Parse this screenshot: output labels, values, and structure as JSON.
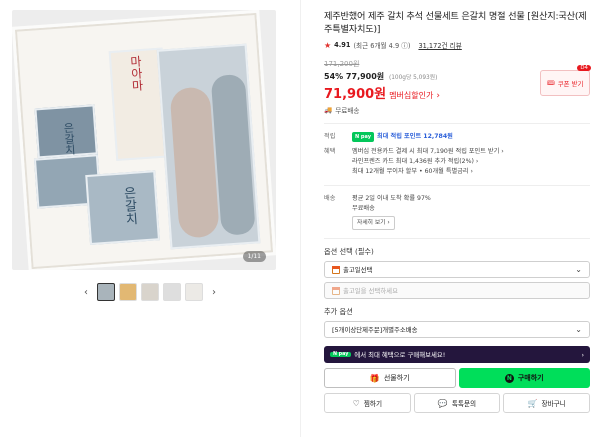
{
  "gallery": {
    "counter": "1/11",
    "pack_labels": [
      "은갈치",
      "은갈치",
      "마아마"
    ],
    "prev_arrow": "‹",
    "next_arrow": "›"
  },
  "product": {
    "title": "제주반했어 제주 갈치 추석 선물세트 은갈치 명절 선물 [원산지:국산(제주특별자치도)]",
    "rating_score": "4.91",
    "rating_note": "(최근 6개월 4.9 ⓘ)",
    "review_count": "31,172건 리뷰",
    "original_price": "171,200원",
    "sale_line": "54% 77,900원",
    "unit_price": "(100g당 5,093원)",
    "member_price": "71,900원",
    "member_label": "멤버십할인가",
    "coupon_label": "쿠폰 받기",
    "coupon_badge": "D4",
    "shipping": "무료배송"
  },
  "benefits": {
    "point_key": "적립",
    "point_badge": "N pay",
    "point_text": "최대 적립 포인트 12,784원",
    "benefit_key": "혜택",
    "benefit_lines": [
      "멤버십 전용카드 결제 시 최대 7,190원 적립 포인트 받기 ›",
      "라인프렌즈 카드 최대 1,436원 추가 적립(2%) ›",
      "최대 12개월 무이자 할부 • 60개월 특별금리 ›"
    ],
    "delivery_key": "배송",
    "delivery_lines": [
      "평균 2일 이내 도착 확률 97%",
      "무료배송"
    ],
    "more_label": "자세히 보기 ›"
  },
  "options": {
    "label": "옵션 선택 (필수)",
    "select1": "출고일선택",
    "select2": "출고일을 선택하세요",
    "add_label": "추가 옵션",
    "select3": "[5개이상단제주문]개별주소배송"
  },
  "banner": {
    "badge": "N pay",
    "text": "에서 최대 혜택으로 구매해보세요!",
    "arrow": "›"
  },
  "actions": {
    "gift": "선물하기",
    "buy": "구매하기",
    "wish": "찜하기",
    "talk": "톡톡문의",
    "cart": "장바구니"
  },
  "icons": {
    "star": "star-icon",
    "truck": "truck-icon",
    "calendar": "calendar-icon",
    "gift": "gift-icon",
    "heart": "heart-icon",
    "chat": "chat-icon",
    "cart": "cart-icon"
  },
  "colors": {
    "accent_red": "#e8191f",
    "npay_green": "#03c75a",
    "buy_green": "#00de5a",
    "banner_bg": "#24163d",
    "link_blue": "#2b5fd9"
  }
}
